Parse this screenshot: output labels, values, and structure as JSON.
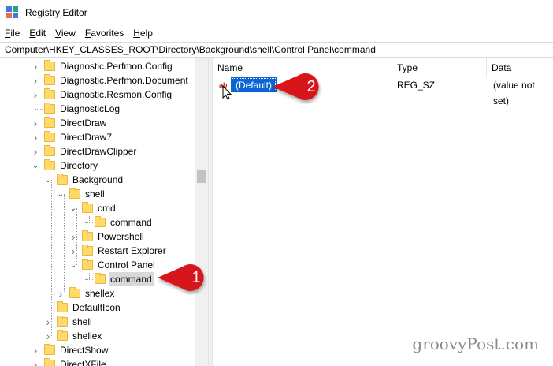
{
  "window": {
    "title": "Registry Editor"
  },
  "menu": [
    {
      "label": "File",
      "underline": "F",
      "rest": "ile"
    },
    {
      "label": "Edit",
      "underline": "E",
      "rest": "dit"
    },
    {
      "label": "View",
      "underline": "V",
      "rest": "iew"
    },
    {
      "label": "Favorites",
      "underline": "F",
      "rest": "avorites"
    },
    {
      "label": "Help",
      "underline": "H",
      "rest": "elp"
    }
  ],
  "address": "Computer\\HKEY_CLASSES_ROOT\\Directory\\Background\\shell\\Control Panel\\command",
  "tree": {
    "items": [
      {
        "label": "Diagnostic.Perfmon.Config",
        "expander": "collapsed"
      },
      {
        "label": "Diagnostic.Perfmon.Document",
        "expander": "collapsed"
      },
      {
        "label": "Diagnostic.Resmon.Config",
        "expander": "collapsed"
      },
      {
        "label": "DiagnosticLog",
        "expander": "none"
      },
      {
        "label": "DirectDraw",
        "expander": "collapsed"
      },
      {
        "label": "DirectDraw7",
        "expander": "collapsed"
      },
      {
        "label": "DirectDrawClipper",
        "expander": "collapsed"
      },
      {
        "label": "Directory",
        "expander": "expanded"
      },
      {
        "label": "Background",
        "expander": "expanded"
      },
      {
        "label": "shell",
        "expander": "expanded"
      },
      {
        "label": "cmd",
        "expander": "expanded"
      },
      {
        "label": "command",
        "expander": "none"
      },
      {
        "label": "Powershell",
        "expander": "collapsed"
      },
      {
        "label": "Restart Explorer",
        "expander": "collapsed"
      },
      {
        "label": "Control Panel",
        "expander": "expanded"
      },
      {
        "label": "command",
        "expander": "none",
        "selected": true
      },
      {
        "label": "shellex",
        "expander": "collapsed"
      },
      {
        "label": "DefaultIcon",
        "expander": "none"
      },
      {
        "label": "shell",
        "expander": "collapsed"
      },
      {
        "label": "shellex",
        "expander": "collapsed"
      },
      {
        "label": "DirectShow",
        "expander": "collapsed"
      },
      {
        "label": "DirectXFile",
        "expander": "collapsed"
      }
    ]
  },
  "list": {
    "columns": [
      "Name",
      "Type",
      "Data"
    ],
    "rows": [
      {
        "name": "(Default)",
        "type": "REG_SZ",
        "data": "(value not set)",
        "icon": "ab"
      }
    ]
  },
  "callouts": [
    {
      "number": "1"
    },
    {
      "number": "2"
    }
  ],
  "watermark": "groovyPost.com",
  "colors": {
    "selection": "#0a64d6",
    "callout": "#d7191c",
    "folder": "#ffd96a"
  }
}
